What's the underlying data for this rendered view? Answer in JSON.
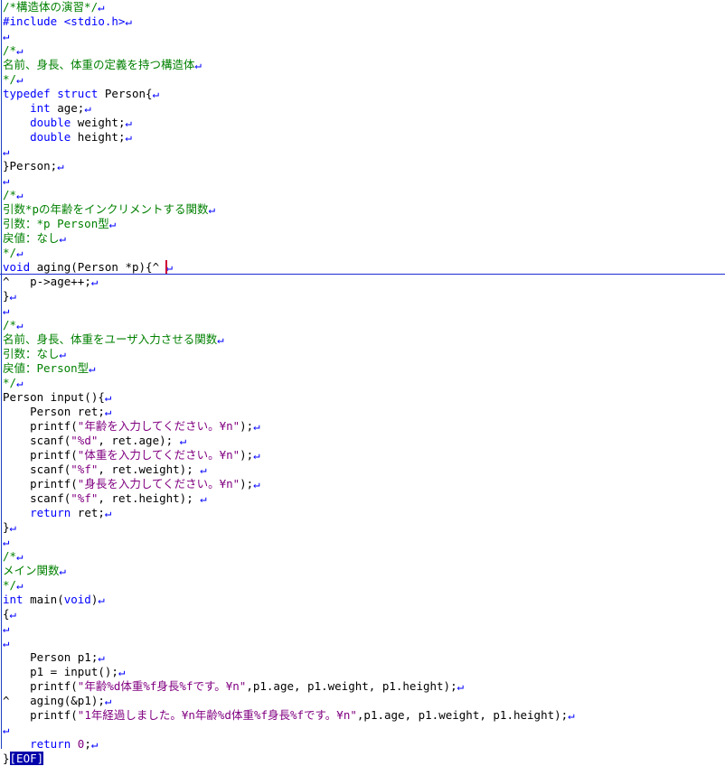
{
  "editor": {
    "cursor_line": 18,
    "eof_marker": "[EOF]",
    "newline_mark": "↵",
    "lines": [
      [
        {
          "t": "/*構造体の演習*/",
          "c": "cm"
        }
      ],
      [
        {
          "t": "#include <stdio.h>",
          "c": "pp"
        }
      ],
      [],
      [
        {
          "t": "/*",
          "c": "cm"
        }
      ],
      [
        {
          "t": "名前、身長、体重の定義を持つ構造体",
          "c": "cm"
        }
      ],
      [
        {
          "t": "*/",
          "c": "cm"
        }
      ],
      [
        {
          "t": "typedef",
          "c": "kw"
        },
        {
          "t": " "
        },
        {
          "t": "struct",
          "c": "kw"
        },
        {
          "t": " Person{"
        }
      ],
      [
        {
          "t": "    "
        },
        {
          "t": "int",
          "c": "kw"
        },
        {
          "t": " age;"
        }
      ],
      [
        {
          "t": "    "
        },
        {
          "t": "double",
          "c": "kw"
        },
        {
          "t": " weight;"
        }
      ],
      [
        {
          "t": "    "
        },
        {
          "t": "double",
          "c": "kw"
        },
        {
          "t": " height;"
        }
      ],
      [],
      [
        {
          "t": "}Person;"
        }
      ],
      [],
      [
        {
          "t": "/*",
          "c": "cm"
        }
      ],
      [
        {
          "t": "引数*pの年齢をインクリメントする関数",
          "c": "cm"
        }
      ],
      [
        {
          "t": "引数：*p Person型",
          "c": "cm"
        }
      ],
      [
        {
          "t": "戻値：なし",
          "c": "cm"
        }
      ],
      [
        {
          "t": "*/",
          "c": "cm"
        }
      ],
      [
        {
          "t": "void",
          "c": "kw"
        },
        {
          "t": " aging(Person *p){"
        },
        {
          "t": "^ ",
          "c": "mk"
        }
      ],
      [
        {
          "t": "^",
          "c": "mk"
        },
        {
          "t": "   p->age++;"
        }
      ],
      [
        {
          "t": "}"
        }
      ],
      [],
      [
        {
          "t": "/*",
          "c": "cm"
        }
      ],
      [
        {
          "t": "名前、身長、体重をユーザ入力させる関数",
          "c": "cm"
        }
      ],
      [
        {
          "t": "引数：なし",
          "c": "cm"
        }
      ],
      [
        {
          "t": "戻値：Person型",
          "c": "cm"
        }
      ],
      [
        {
          "t": "*/",
          "c": "cm"
        }
      ],
      [
        {
          "t": "Person input(){"
        }
      ],
      [
        {
          "t": "    Person ret;"
        }
      ],
      [
        {
          "t": "    printf("
        },
        {
          "t": "\"年齢を入力してください。¥n\"",
          "c": "str"
        },
        {
          "t": ");"
        }
      ],
      [
        {
          "t": "    scanf("
        },
        {
          "t": "\"%d\"",
          "c": "str"
        },
        {
          "t": ", ret.age); "
        }
      ],
      [
        {
          "t": "    printf("
        },
        {
          "t": "\"体重を入力してください。¥n\"",
          "c": "str"
        },
        {
          "t": ");"
        }
      ],
      [
        {
          "t": "    scanf("
        },
        {
          "t": "\"%f\"",
          "c": "str"
        },
        {
          "t": ", ret.weight); "
        }
      ],
      [
        {
          "t": "    printf("
        },
        {
          "t": "\"身長を入力してください。¥n\"",
          "c": "str"
        },
        {
          "t": ");"
        }
      ],
      [
        {
          "t": "    scanf("
        },
        {
          "t": "\"%f\"",
          "c": "str"
        },
        {
          "t": ", ret.height); "
        }
      ],
      [
        {
          "t": "    "
        },
        {
          "t": "return",
          "c": "kw"
        },
        {
          "t": " ret;"
        }
      ],
      [
        {
          "t": "}"
        }
      ],
      [],
      [
        {
          "t": "/*",
          "c": "cm"
        }
      ],
      [
        {
          "t": "メイン関数",
          "c": "cm"
        }
      ],
      [
        {
          "t": "*/",
          "c": "cm"
        }
      ],
      [
        {
          "t": "int",
          "c": "kw"
        },
        {
          "t": " main("
        },
        {
          "t": "void",
          "c": "kw"
        },
        {
          "t": ")"
        }
      ],
      [
        {
          "t": "{"
        }
      ],
      [],
      [],
      [
        {
          "t": "    Person p1;"
        }
      ],
      [
        {
          "t": "    p1 = input();"
        }
      ],
      [
        {
          "t": "    printf("
        },
        {
          "t": "\"年齢%d体重%f身長%fです。¥n\"",
          "c": "str"
        },
        {
          "t": ",p1.age, p1.weight, p1.height);"
        }
      ],
      [
        {
          "t": "^",
          "c": "mk"
        },
        {
          "t": "   aging(&p1);"
        }
      ],
      [
        {
          "t": "    printf("
        },
        {
          "t": "\"1年経過しました。¥n年齢%d体重%f身長%fです。¥n\"",
          "c": "str"
        },
        {
          "t": ",p1.age, p1.weight, p1.height);"
        }
      ],
      [],
      [
        {
          "t": "    "
        },
        {
          "t": "return",
          "c": "kw"
        },
        {
          "t": " "
        },
        {
          "t": "0",
          "c": "num"
        },
        {
          "t": ";"
        }
      ],
      [
        {
          "t": "}"
        }
      ]
    ]
  }
}
